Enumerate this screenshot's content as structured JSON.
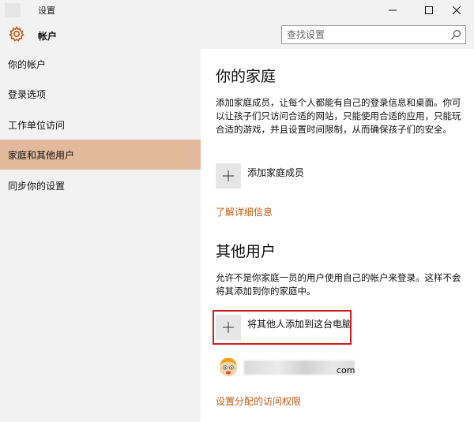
{
  "window": {
    "title": "设置",
    "minimize_icon": "minimize-icon",
    "maximize_icon": "maximize-icon",
    "close_icon": "close-icon"
  },
  "header": {
    "section_icon": "gear-icon",
    "section_title": "帐户",
    "search_placeholder": "查找设置"
  },
  "sidebar": {
    "items": [
      {
        "label": "你的帐户"
      },
      {
        "label": "登录选项"
      },
      {
        "label": "工作单位访问"
      },
      {
        "label": "家庭和其他用户",
        "selected": true
      },
      {
        "label": "同步你的设置"
      }
    ]
  },
  "main": {
    "family": {
      "heading": "你的家庭",
      "description": "添加家庭成员，让每个人都能有自己的登录信息和桌面。你可以让孩子们只访问合适的网站，只能使用合适的应用，只能玩合适的游戏，并且设置时间限制，从而确保孩子们的安全。",
      "add_label": "添加家庭成员",
      "learn_more": "了解详细信息"
    },
    "others": {
      "heading": "其他用户",
      "description": "允许不是你家庭一员的用户使用自己的帐户来登录。这样不会将其添加到你的家庭中。",
      "add_label": "将其他人添加到这台电脑",
      "user_email_suffix": "com",
      "assigned_access": "设置分配的访问权限"
    }
  },
  "colors": {
    "accent": "#e3b99c",
    "link": "#c15a10",
    "highlight_border": "#cc1f1f"
  }
}
